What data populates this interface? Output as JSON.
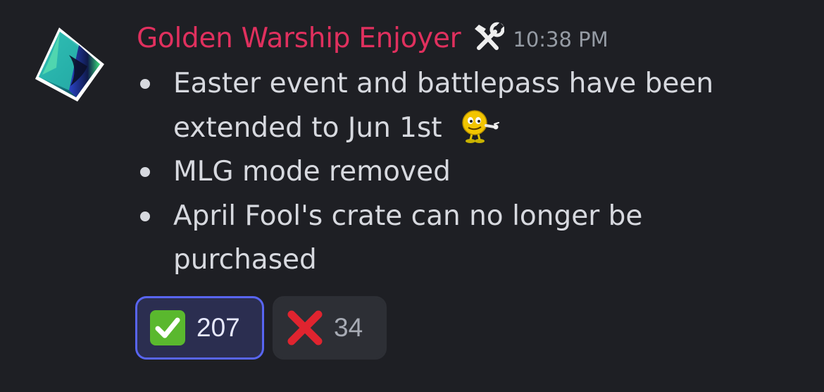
{
  "message": {
    "author": "Golden Warship Enjoyer",
    "role_icon": "hammer-and-wrench-icon",
    "timestamp": "10:38 PM",
    "items": [
      {
        "text": "Easter event and battlepass have been extended to Jun 1st",
        "emoji": "pointing-smiley-emoji"
      },
      {
        "text": "MLG mode removed"
      },
      {
        "text": "April Fool's crate can no longer be purchased"
      }
    ]
  },
  "reactions": [
    {
      "emoji": "check-mark-icon",
      "count": "207",
      "reacted": true
    },
    {
      "emoji": "cross-mark-icon",
      "count": "34",
      "reacted": false
    }
  ],
  "colors": {
    "background": "#1e1f24",
    "username": "#e0305e",
    "text": "#d7d9df",
    "timestamp": "#959ba4",
    "reaction_active_border": "#5865f2",
    "reaction_active_bg": "#2b2e50",
    "reaction_inactive_bg": "#2d2f35"
  }
}
